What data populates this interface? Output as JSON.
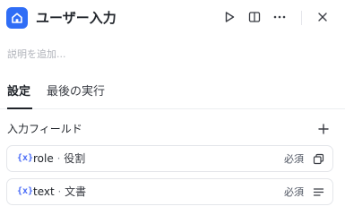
{
  "header": {
    "title": "ユーザー入力",
    "icon": "home-icon",
    "accent_color": "#2f6df6",
    "actions": [
      "play-icon",
      "split-panel-icon",
      "more-icon",
      "close-icon"
    ]
  },
  "description": {
    "placeholder": "説明を追加..."
  },
  "tabs": [
    {
      "label": "設定",
      "active": true
    },
    {
      "label": "最後の実行",
      "active": false
    }
  ],
  "input_fields": {
    "title": "入力フィールド",
    "items": [
      {
        "var_symbol": "{x}",
        "name": "role",
        "separator": "·",
        "type": "役割",
        "required_label": "必須",
        "type_icon": "copy-icon"
      },
      {
        "var_symbol": "{x}",
        "name": "text",
        "separator": "·",
        "type": "文書",
        "required_label": "必須",
        "type_icon": "text-lines-icon"
      }
    ]
  }
}
